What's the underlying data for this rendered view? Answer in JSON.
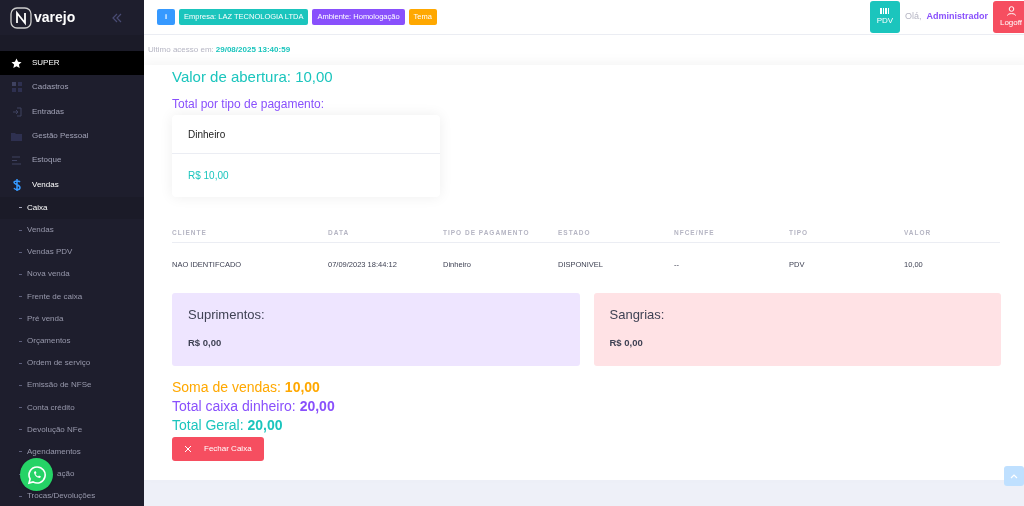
{
  "sidebar": {
    "brand": "varejo",
    "items": [
      {
        "label": "SUPER",
        "selected": true
      },
      {
        "label": "Cadastros",
        "selected": false
      },
      {
        "label": "Entradas",
        "selected": false
      },
      {
        "label": "Gestão Pessoal",
        "selected": false
      },
      {
        "label": "Estoque",
        "selected": false
      },
      {
        "label": "Vendas",
        "selected": false,
        "children": [
          {
            "label": "Caixa",
            "selected": true
          },
          {
            "label": "Vendas",
            "selected": false
          },
          {
            "label": "Vendas PDV",
            "selected": false
          },
          {
            "label": "Nova venda",
            "selected": false
          },
          {
            "label": "Frente de caixa",
            "selected": false
          },
          {
            "label": "Pré venda",
            "selected": false
          },
          {
            "label": "Orçamentos",
            "selected": false
          },
          {
            "label": "Ordem de serviço",
            "selected": false
          },
          {
            "label": "Emissão de NFSe",
            "selected": false
          },
          {
            "label": "Conta crédito",
            "selected": false
          },
          {
            "label": "Devolução NFe",
            "selected": false
          },
          {
            "label": "Agendamentos",
            "selected": false
          },
          {
            "label": "ação",
            "selected": false
          },
          {
            "label": "Trocas/Devoluções",
            "selected": false
          }
        ]
      }
    ]
  },
  "header": {
    "badges": [
      {
        "label": "i",
        "color": "#3699ff"
      },
      {
        "label": "Empresa: LAZ TECNOLOGIA LTDA",
        "color": "#1bc5bd"
      },
      {
        "label": "Ambiente: Homologação",
        "color": "#8950fc"
      },
      {
        "label": "Tema",
        "color": "#ffa800"
      }
    ],
    "pdv_button": "PDV",
    "greeting": "Olá,",
    "user": "Administrador",
    "logoff_button": "Logoff"
  },
  "last_access": {
    "label": "Ultimo acesso em:",
    "value": "29/08/2025 13:40:59"
  },
  "opening_value": "Valor de abertura: 10,00",
  "payment_title": "Total por tipo de pagamento:",
  "payment_cards": [
    {
      "name": "Dinheiro",
      "amount": "R$ 10,00"
    }
  ],
  "table": {
    "columns": [
      "CLIENTE",
      "DATA",
      "TIPO DE PAGAMENTO",
      "ESTADO",
      "NFCE/NFE",
      "TIPO",
      "VALOR"
    ],
    "rows": [
      [
        "NAO IDENTIFCADO",
        "07/09/2023 18:44:12",
        "Dinheiro",
        "DISPONIVEL",
        "--",
        "PDV",
        "10,00"
      ]
    ]
  },
  "cash_cards": [
    {
      "kind": "supply",
      "title": "Suprimentos:",
      "amount": "R$ 0,00"
    },
    {
      "kind": "withdrawal",
      "title": "Sangrias:",
      "amount": "R$ 0,00"
    }
  ],
  "totals": [
    {
      "text": "Soma de vendas: **10,00**",
      "color": "#ffa800"
    },
    {
      "text": "Total caixa dinheiro: **20,00**",
      "color": "#8950fc"
    },
    {
      "text": "Total Geral: **20,00**",
      "color": "#1bc5bd"
    }
  ],
  "close_button": "Fechar Caixa"
}
